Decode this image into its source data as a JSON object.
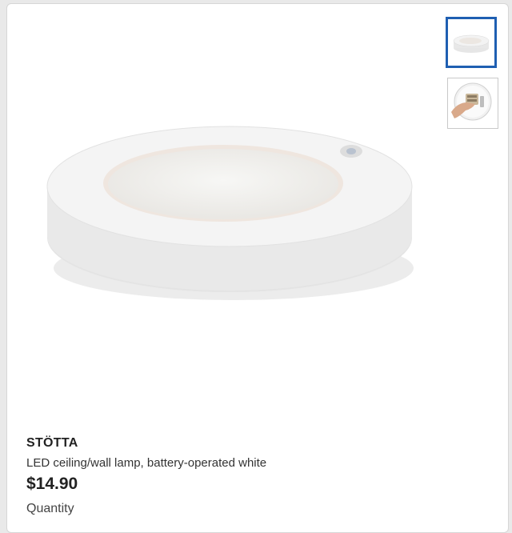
{
  "product": {
    "name": "STÖTTA",
    "description": "LED ceiling/wall lamp, battery-operated white",
    "price": "$14.90",
    "quantity_label": "Quantity"
  },
  "gallery": {
    "main_image": "round-white-led-lamp",
    "thumbnails": [
      {
        "icon": "lamp-thumbnail",
        "selected": true
      },
      {
        "icon": "lamp-in-hand-thumbnail",
        "selected": false
      }
    ]
  },
  "colors": {
    "accent": "#1f5fb2",
    "background": "#e9e9e9"
  }
}
